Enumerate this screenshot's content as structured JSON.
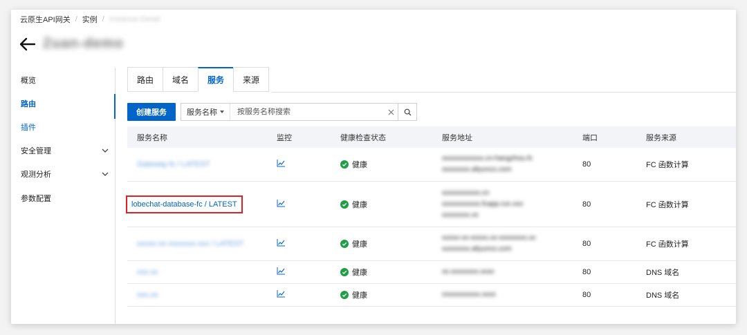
{
  "breadcrumb": {
    "root": "云原生API网关",
    "instances": "实例",
    "current": "Instance-Detail"
  },
  "header": {
    "title": "Zuan-demo"
  },
  "sidebar": {
    "items": [
      {
        "label": "概览"
      },
      {
        "label": "路由"
      },
      {
        "label": "插件"
      },
      {
        "label": "安全管理"
      },
      {
        "label": "观测分析"
      },
      {
        "label": "参数配置"
      }
    ]
  },
  "tabs": [
    {
      "label": "路由"
    },
    {
      "label": "域名"
    },
    {
      "label": "服务"
    },
    {
      "label": "来源"
    }
  ],
  "toolbar": {
    "create_label": "创建服务",
    "filter_label": "服务名称",
    "search_placeholder": "按服务名称搜索"
  },
  "table": {
    "headers": [
      "服务名称",
      "监控",
      "健康检查状态",
      "服务地址",
      "端口",
      "服务来源"
    ],
    "rows": [
      {
        "name": "Gateway-fc / LATEST",
        "health": "健康",
        "address": [
          "xxxxxxxxxxxx.cn-hangzhou.fc",
          "xxxxxxxx.aliyuncs.com"
        ],
        "port": "80",
        "source": "FC 函数计算"
      },
      {
        "name": "lobechat-database-fc / LATEST",
        "health": "健康",
        "address": [
          "xxxxxxxxxxx.cn",
          "xxxxxxxxxxx.fcapp.run.xxx",
          "xxxxxxxx.xx"
        ],
        "port": "80",
        "source": "FC 函数计算"
      },
      {
        "name": "xxxxx-xx-xxxxxxx-xxx / LATEST",
        "health": "健康",
        "address": [
          "xxxxx-xx-xxxxx.xx-xxxxxxxx.xx",
          "xxxxxxxx.aliyuncs.com"
        ],
        "port": "80",
        "source": "FC 函数计算"
      },
      {
        "name": "xxx.xx",
        "health": "健康",
        "address": [
          "xx.xxxxxxxx.xxxx"
        ],
        "port": "80",
        "source": "DNS 域名"
      },
      {
        "name": "xxx.xx",
        "health": "健康",
        "address": [
          "xxxxxxxxxxx.xxxx"
        ],
        "port": "80",
        "source": "DNS 域名"
      }
    ]
  },
  "colors": {
    "primary": "#0064c8",
    "success": "#1e9e45",
    "highlight": "#e02020"
  },
  "icons": {
    "back": "arrow-left-icon",
    "chevron": "chevron-down-icon",
    "caret": "caret-down-icon",
    "clear": "close-icon",
    "search": "search-icon",
    "monitor": "line-chart-icon",
    "health": "check-circle-icon"
  }
}
